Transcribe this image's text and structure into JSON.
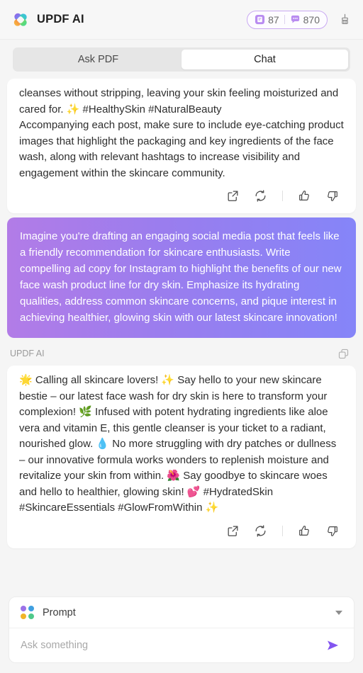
{
  "header": {
    "brand_title": "UPDF AI",
    "logo_icon": "clover-logo-icon",
    "credits": {
      "doc_icon": "document-badge-icon",
      "doc_count": "87",
      "chat_icon": "chat-bubble-badge-icon",
      "chat_count": "870"
    },
    "clear_icon": "broom-icon"
  },
  "tabs": [
    {
      "label": "Ask PDF",
      "active": false
    },
    {
      "label": "Chat",
      "active": true
    }
  ],
  "messages": [
    {
      "role": "assistant",
      "truncated_top": true,
      "text": "cleanses without stripping, leaving your skin feeling moisturized and cared for. ✨ #HealthySkin #NaturalBeauty\nAccompanying each post, make sure to include eye-catching product images that highlight the packaging and key ingredients of the face wash, along with relevant hashtags to increase visibility and engagement within the skincare community."
    },
    {
      "role": "user",
      "text": "Imagine you're drafting an engaging social media post that feels like a friendly recommendation for skincare enthusiasts. Write compelling ad copy for Instagram to highlight the benefits of our new face wash product line for dry skin. Emphasize its hydrating qualities, address common skincare concerns, and pique interest in achieving healthier, glowing skin with our latest skincare innovation!"
    },
    {
      "role": "assistant",
      "sender_label": "UPDF AI",
      "text": "🌟 Calling all skincare lovers! ✨ Say hello to your new skincare bestie – our latest face wash for dry skin is here to transform your complexion! 🌿 Infused with potent hydrating ingredients like aloe vera and vitamin E, this gentle cleanser is your ticket to a radiant, nourished glow. 💧 No more struggling with dry patches or dullness – our innovative formula works wonders to replenish moisture and revitalize your skin from within. 🌺 Say goodbye to skincare woes and hello to healthier, glowing skin! 💕 #HydratedSkin #SkincareEssentials #GlowFromWithin ✨"
    }
  ],
  "message_actions": {
    "share_icon": "external-link-icon",
    "regenerate_icon": "refresh-icon",
    "like_icon": "thumbs-up-icon",
    "dislike_icon": "thumbs-down-icon"
  },
  "copy_icon": "copy-icon",
  "composer": {
    "prompt_label": "Prompt",
    "prompt_icon": "four-dots-icon",
    "chevron_icon": "chevron-down-icon",
    "input_placeholder": "Ask something",
    "input_value": "",
    "send_icon": "send-arrow-icon"
  },
  "colors": {
    "accent_purple": "#8355f0",
    "bubble_start": "#b27ce7",
    "bubble_end": "#8585f8",
    "badge_border": "#c9a9f2",
    "page_bg": "#f5f5f5"
  }
}
